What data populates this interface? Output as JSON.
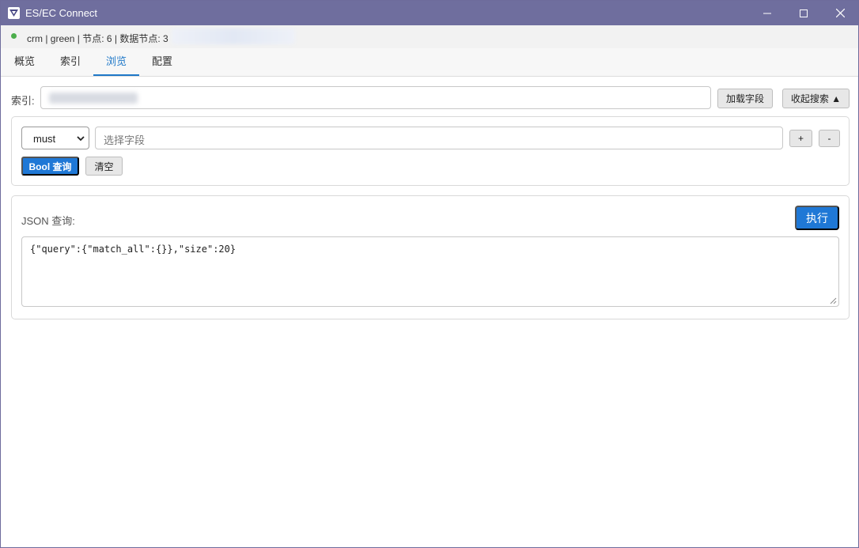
{
  "window": {
    "title": "ES/EC Connect",
    "controls": {
      "minimize": "minimize-icon",
      "maximize": "maximize-icon",
      "close": "close-icon"
    }
  },
  "status": {
    "indicator_color": "#4cae4c",
    "text": "crm | green | 节点: 6 | 数据节点: 3"
  },
  "tabs": [
    {
      "label": "概览",
      "active": false
    },
    {
      "label": "索引",
      "active": false
    },
    {
      "label": "浏览",
      "active": true
    },
    {
      "label": "配置",
      "active": false
    }
  ],
  "index_row": {
    "label": "索引:",
    "load_fields_button": "加载字段",
    "collapse_search_button": "收起搜索 ▲"
  },
  "bool_query": {
    "occur_select": {
      "selected": "must"
    },
    "field_input": {
      "placeholder": "选择字段"
    },
    "add_button": "+",
    "remove_button": "-",
    "bool_query_button": "Bool 查询",
    "clear_button": "清空"
  },
  "json_query": {
    "label": "JSON 查询:",
    "execute_button": "执行",
    "query_text": "{\"query\":{\"match_all\":{}},\"size\":20}"
  },
  "colors": {
    "titlebar": "#6f6e9e",
    "accent": "#1f78d6",
    "status_green": "#4cae4c"
  }
}
